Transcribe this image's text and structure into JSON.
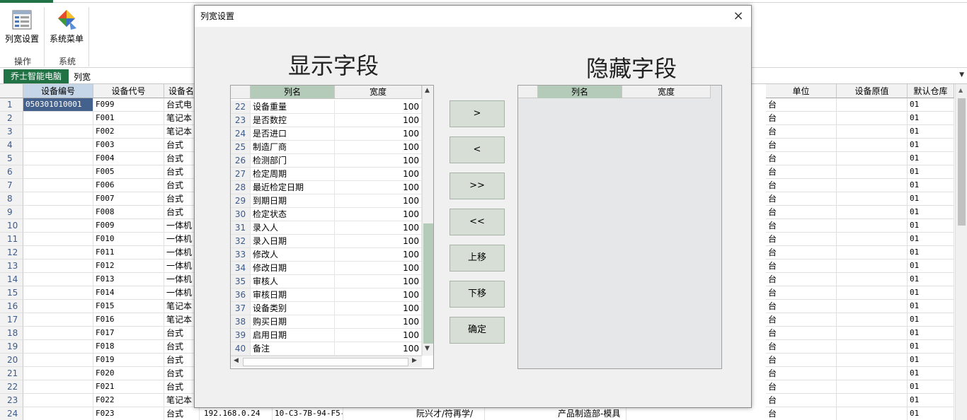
{
  "ribbon": {
    "btn_colwidth": "列宽设置",
    "btn_sysmenu": "系统菜单",
    "group_ops": "操作",
    "group_sys": "系统"
  },
  "tabs": {
    "active": "乔士智能电脑",
    "label": "列宽"
  },
  "grid": {
    "headers_left": [
      "设备编号",
      "设备代号",
      "设备名"
    ],
    "headers_right": [
      "单位",
      "设备原值",
      "默认仓库"
    ],
    "rows": [
      {
        "n": "1",
        "code": "050301010001",
        "id": "F099",
        "name": "台式电",
        "unit": "台",
        "wh": "01"
      },
      {
        "n": "2",
        "code": "",
        "id": "F001",
        "name": "笔记本",
        "unit": "台",
        "wh": "01"
      },
      {
        "n": "3",
        "code": "",
        "id": "F002",
        "name": "笔记本",
        "unit": "台",
        "wh": "01"
      },
      {
        "n": "4",
        "code": "",
        "id": "F003",
        "name": "台式",
        "unit": "台",
        "wh": "01"
      },
      {
        "n": "5",
        "code": "",
        "id": "F004",
        "name": "台式",
        "unit": "台",
        "wh": "01"
      },
      {
        "n": "6",
        "code": "",
        "id": "F005",
        "name": "台式",
        "unit": "台",
        "wh": "01"
      },
      {
        "n": "7",
        "code": "",
        "id": "F006",
        "name": "台式",
        "unit": "台",
        "wh": "01"
      },
      {
        "n": "8",
        "code": "",
        "id": "F007",
        "name": "台式",
        "unit": "台",
        "wh": "01"
      },
      {
        "n": "9",
        "code": "",
        "id": "F008",
        "name": "台式",
        "unit": "台",
        "wh": "01"
      },
      {
        "n": "10",
        "code": "",
        "id": "F009",
        "name": "一体机",
        "unit": "台",
        "wh": "01"
      },
      {
        "n": "11",
        "code": "",
        "id": "F010",
        "name": "一体机",
        "unit": "台",
        "wh": "01"
      },
      {
        "n": "12",
        "code": "",
        "id": "F011",
        "name": "一体机",
        "unit": "台",
        "wh": "01"
      },
      {
        "n": "13",
        "code": "",
        "id": "F012",
        "name": "一体机",
        "unit": "台",
        "wh": "01"
      },
      {
        "n": "14",
        "code": "",
        "id": "F013",
        "name": "一体机",
        "unit": "台",
        "wh": "01"
      },
      {
        "n": "15",
        "code": "",
        "id": "F014",
        "name": "一体机",
        "unit": "台",
        "wh": "01"
      },
      {
        "n": "16",
        "code": "",
        "id": "F015",
        "name": "笔记本",
        "unit": "台",
        "wh": "01"
      },
      {
        "n": "17",
        "code": "",
        "id": "F016",
        "name": "笔记本",
        "unit": "台",
        "wh": "01"
      },
      {
        "n": "18",
        "code": "",
        "id": "F017",
        "name": "台式",
        "unit": "台",
        "wh": "01"
      },
      {
        "n": "19",
        "code": "",
        "id": "F018",
        "name": "台式",
        "unit": "台",
        "wh": "01"
      },
      {
        "n": "20",
        "code": "",
        "id": "F019",
        "name": "台式",
        "unit": "台",
        "wh": "01"
      },
      {
        "n": "21",
        "code": "",
        "id": "F020",
        "name": "台式",
        "unit": "台",
        "wh": "01"
      },
      {
        "n": "22",
        "code": "",
        "id": "F021",
        "name": "台式",
        "unit": "台",
        "wh": "01"
      },
      {
        "n": "23",
        "code": "",
        "id": "F022",
        "name": "笔记本",
        "unit": "台",
        "wh": "01"
      },
      {
        "n": "24",
        "code": "",
        "id": "F023",
        "name": "台式",
        "unit": "台",
        "wh": "01"
      }
    ],
    "row24_extra": {
      "ip": "192.168.0.24",
      "mac": "10-C3-7B-94-F5-",
      "user": "阮兴才/符再学/",
      "dept": "产品制造部-模具"
    }
  },
  "dialog": {
    "title": "列宽设置",
    "left_heading": "显示字段",
    "right_heading": "隐藏字段",
    "col_name": "列名",
    "col_width": "宽度",
    "fields": [
      {
        "n": "22",
        "name": "设备重量",
        "w": "100"
      },
      {
        "n": "23",
        "name": "是否数控",
        "w": "100"
      },
      {
        "n": "24",
        "name": "是否进口",
        "w": "100"
      },
      {
        "n": "25",
        "name": "制造厂商",
        "w": "100"
      },
      {
        "n": "26",
        "name": "检测部门",
        "w": "100"
      },
      {
        "n": "27",
        "name": "检定周期",
        "w": "100"
      },
      {
        "n": "28",
        "name": "最近检定日期",
        "w": "100"
      },
      {
        "n": "29",
        "name": "到期日期",
        "w": "100"
      },
      {
        "n": "30",
        "name": "检定状态",
        "w": "100"
      },
      {
        "n": "31",
        "name": "录入人",
        "w": "100"
      },
      {
        "n": "32",
        "name": "录入日期",
        "w": "100"
      },
      {
        "n": "33",
        "name": "修改人",
        "w": "100"
      },
      {
        "n": "34",
        "name": "修改日期",
        "w": "100"
      },
      {
        "n": "35",
        "name": "审核人",
        "w": "100"
      },
      {
        "n": "36",
        "name": "审核日期",
        "w": "100"
      },
      {
        "n": "37",
        "name": "设备类别",
        "w": "100"
      },
      {
        "n": "38",
        "name": "购买日期",
        "w": "100"
      },
      {
        "n": "39",
        "name": "启用日期",
        "w": "100"
      },
      {
        "n": "40",
        "name": "备注",
        "w": "100"
      }
    ],
    "btn_move_right": ">",
    "btn_move_left": "<",
    "btn_move_all_right": ">>",
    "btn_move_all_left": "<<",
    "btn_up": "上移",
    "btn_down": "下移",
    "btn_ok": "确定",
    "close_icon": "×"
  }
}
